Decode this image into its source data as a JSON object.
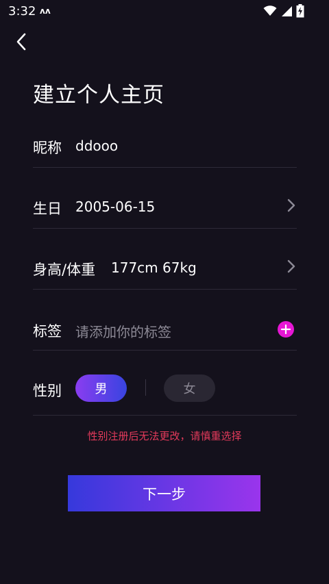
{
  "status_bar": {
    "time": "3:32",
    "app_icon": "zk-icon",
    "icons": [
      "wifi-icon",
      "signal-icon",
      "battery-charging-icon"
    ]
  },
  "header": {
    "back_icon": "chevron-left-icon",
    "title": "建立个人主页"
  },
  "form": {
    "nickname": {
      "label": "昵称",
      "value": "ddooo"
    },
    "birthday": {
      "label": "生日",
      "value": "2005-06-15",
      "icon": "chevron-right-icon"
    },
    "body": {
      "label": "身高/体重",
      "value": "177cm 67kg",
      "icon": "chevron-right-icon"
    },
    "tags": {
      "label": "标签",
      "placeholder": "请添加你的标签",
      "icon": "plus-circle-icon"
    },
    "gender": {
      "label": "性别",
      "options": [
        "男",
        "女"
      ],
      "selected": "男"
    }
  },
  "warning": "性别注册后无法更改，请慎重选择",
  "next_button": "下一步",
  "colors": {
    "background": "#14111c",
    "accent_pink": "#e616d4",
    "warning": "#e33a5b",
    "gradient_start": "#3639dc",
    "gradient_end": "#9a35ec"
  }
}
